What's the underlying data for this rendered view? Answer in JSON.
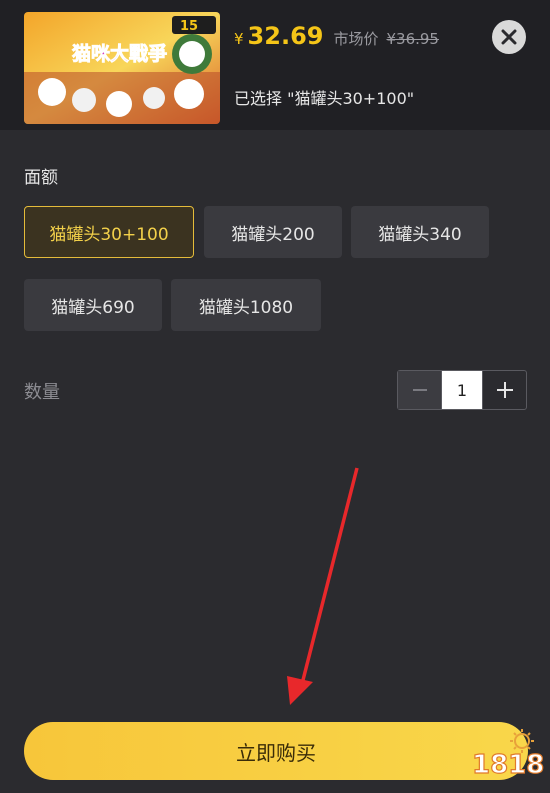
{
  "product": {
    "thumbnail_label": "猫咪大戰爭",
    "thumbnail_badge": "15",
    "currency": "¥",
    "price": "32.69",
    "market_label": "市场价",
    "market_price": "¥36.95",
    "selected_text": "已选择 \"猫罐头30+100\""
  },
  "denomination": {
    "title": "面额",
    "options": [
      "猫罐头30+100",
      "猫罐头200",
      "猫罐头340",
      "猫罐头690",
      "猫罐头1080"
    ],
    "selected_index": 0
  },
  "quantity": {
    "label": "数量",
    "value": "1",
    "minus": "−",
    "plus": "+"
  },
  "buy_button": {
    "label": "立即购买"
  },
  "watermark": {
    "text": "1818"
  },
  "colors": {
    "accent": "#f5c518",
    "background": "#2b2b2f",
    "option_bg": "#3a3a3f",
    "arrow": "#e8282b"
  }
}
